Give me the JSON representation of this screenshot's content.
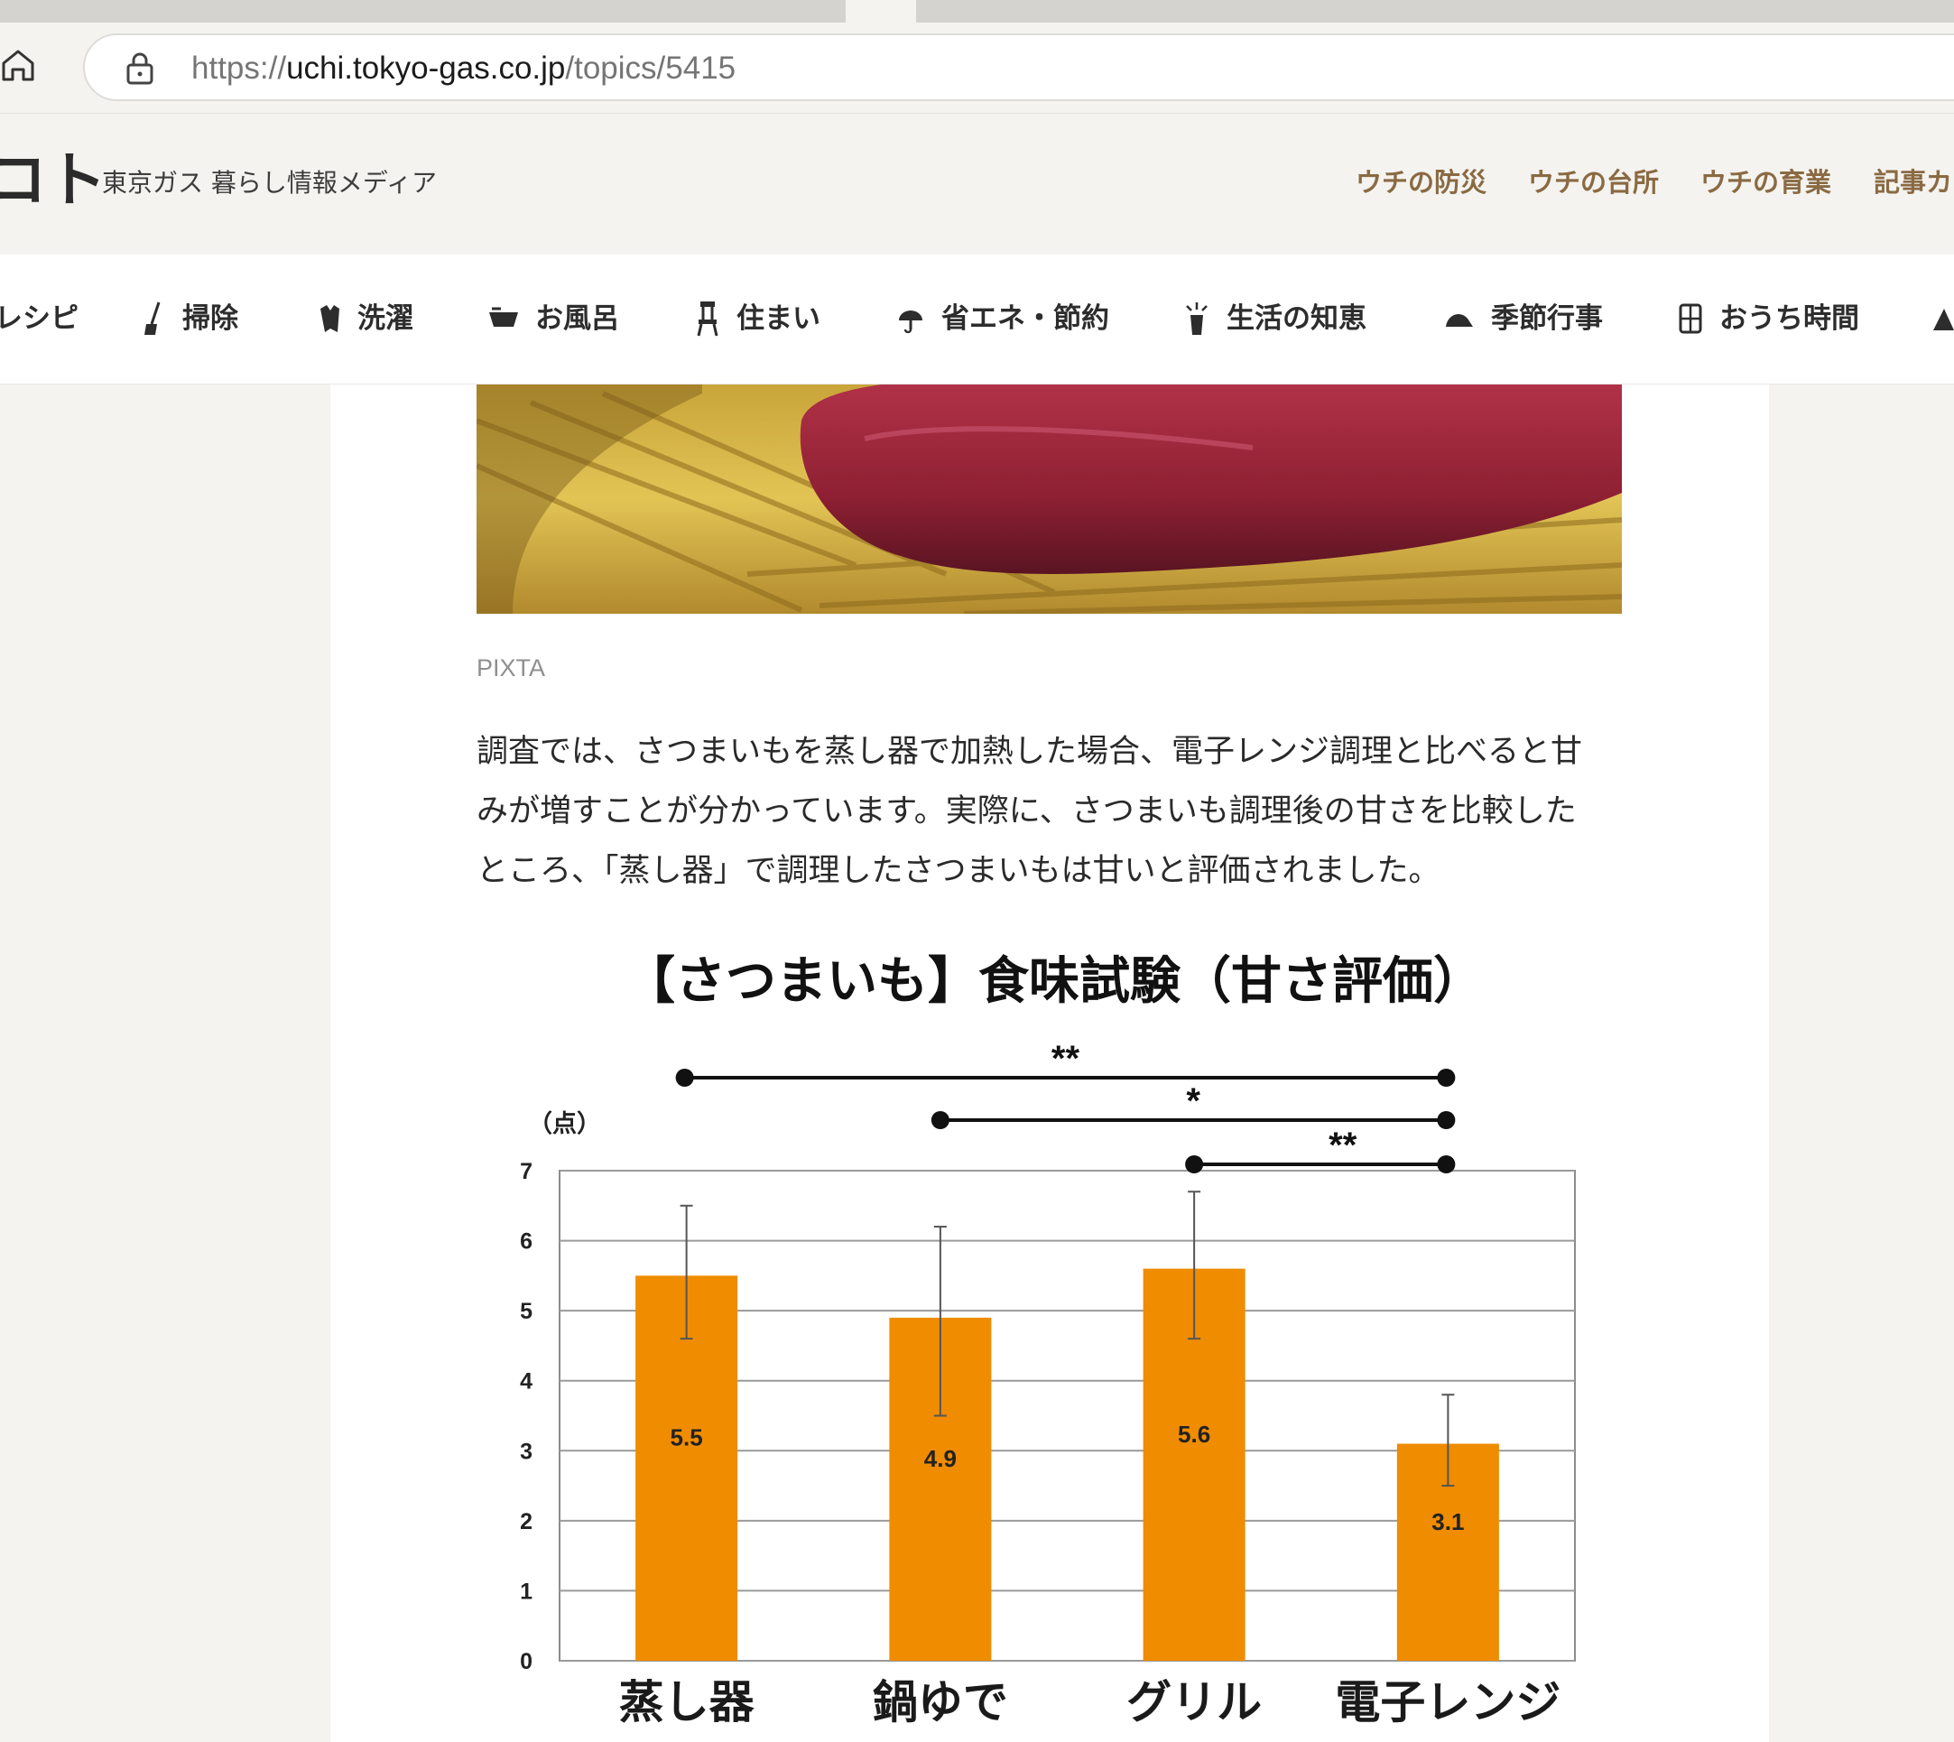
{
  "browser": {
    "url_scheme": "https://",
    "url_host": "uchi.tokyo-gas.co.jp",
    "url_path": "/topics/5415"
  },
  "site": {
    "logo": "コト",
    "tagline": "東京ガス 暮らし情報メディア",
    "top_links": [
      "ウチの防災",
      "ウチの台所",
      "ウチの育業",
      "記事カ"
    ]
  },
  "categories": [
    {
      "label": "レシピ",
      "icon": "recipe-icon"
    },
    {
      "label": "掃除",
      "icon": "broom-icon"
    },
    {
      "label": "洗濯",
      "icon": "shirt-icon"
    },
    {
      "label": "お風呂",
      "icon": "bathtub-icon"
    },
    {
      "label": "住まい",
      "icon": "chair-icon"
    },
    {
      "label": "省エネ・節約",
      "icon": "piggy-icon"
    },
    {
      "label": "生活の知恵",
      "icon": "lightbulb-icon"
    },
    {
      "label": "季節行事",
      "icon": "hat-icon"
    },
    {
      "label": "おうち時間",
      "icon": "house-icon"
    }
  ],
  "article": {
    "photo_caption": "PIXTA",
    "paragraph_lines": [
      "調査では、さつまいもを蒸し器で加熱した場合、電子レンジ調理と比べると甘",
      "みが増すことが分かっています。実際に、さつまいも調理後の甘さを比較した",
      "ところ、「蒸し器」で調理したさつまいもは甘いと評価されました。"
    ]
  },
  "colors": {
    "bar": "#ef8c00",
    "link_brown": "#8a6a43",
    "article_bg": "#ffffff",
    "page_bg": "#f4f3ef"
  },
  "chart_data": {
    "type": "bar",
    "title": "【さつまいも】食味試験（甘さ評価）",
    "ylabel": "（点）",
    "ylim": [
      0,
      7
    ],
    "yticks": [
      0,
      1,
      2,
      3,
      4,
      5,
      6,
      7
    ],
    "categories": [
      "蒸し器",
      "鍋ゆで",
      "グリル",
      "電子レンジ"
    ],
    "series": [
      {
        "values": [
          5.5,
          4.9,
          5.6,
          3.1
        ],
        "value_labels": [
          "5.5",
          "4.9",
          "5.6",
          "3.1"
        ],
        "error_low": [
          4.6,
          3.5,
          4.6,
          2.5
        ],
        "error_high": [
          6.5,
          6.2,
          6.7,
          3.8
        ]
      }
    ],
    "significance": [
      {
        "from": "蒸し器",
        "to": "電子レンジ",
        "mark": "**"
      },
      {
        "from": "鍋ゆで",
        "to": "電子レンジ",
        "mark": "*"
      },
      {
        "from": "グリル",
        "to": "電子レンジ",
        "mark": "**"
      }
    ],
    "grid": true,
    "legend": "none"
  }
}
